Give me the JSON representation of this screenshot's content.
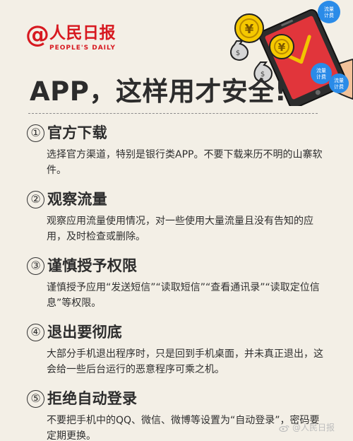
{
  "brand": {
    "logo_title": "人民日报",
    "logo_subtitle": "PEOPLE'S DAILY",
    "icon": "at-logo-icon"
  },
  "illustration": {
    "description": "phone-with-coins-and-bags",
    "label1": "流量\n计费",
    "label2": "流量\n计费",
    "label3": "流量\n计费"
  },
  "headline": "APP，这样用才安全!",
  "sections": [
    {
      "number": "①",
      "title": "官方下载",
      "body": "选择官方渠道，特别是银行类APP。不要下载来历不明的山寨软件。"
    },
    {
      "number": "②",
      "title": "观察流量",
      "body": "观察应用流量使用情况，对一些使用大量流量且没有告知的应用，及时检查或删除。"
    },
    {
      "number": "③",
      "title": "谨慎授予权限",
      "body": "谨慎授予应用“发送短信”“读取短信”“查看通讯录”“读取定位信息”等权限。"
    },
    {
      "number": "④",
      "title": "退出要彻底",
      "body": "大部分手机退出程序时，只是回到手机桌面，并未真正退出，这会给一些后台运行的恶意程序可乘之机。"
    },
    {
      "number": "⑤",
      "title": "拒绝自动登录",
      "body": "不要把手机中的QQ、微信、微博等设置为“自动登录”，密码要定期更换。"
    }
  ],
  "watermark": {
    "text": "@人民日报",
    "icon": "weibo-icon"
  }
}
